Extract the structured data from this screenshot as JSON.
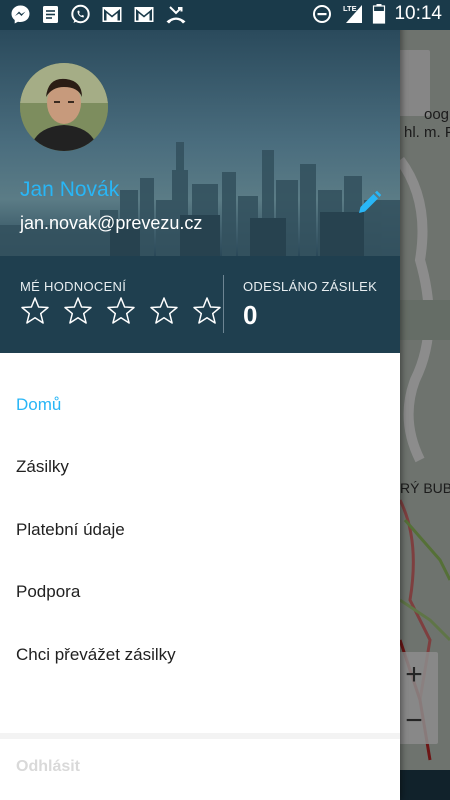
{
  "status_bar": {
    "time": "10:14",
    "network": "LTE",
    "notification_icons": [
      "messenger-icon",
      "document-icon",
      "whatsapp-icon",
      "gmail-icon",
      "gmail-icon",
      "missed-call-icon"
    ]
  },
  "map": {
    "labels": [
      "oog",
      "hl. m. P",
      "RÝ BUBE"
    ],
    "zoom_in": "+",
    "zoom_out": "−"
  },
  "profile": {
    "name": "Jan Novák",
    "email": "jan.novak@prevezu.cz"
  },
  "stats": {
    "rating_label": "MÉ HODNOCENÍ",
    "rating_value": 0,
    "rating_max": 5,
    "sent_label": "ODESLÁNO ZÁSILEK",
    "sent_count": "0"
  },
  "menu": {
    "items": [
      {
        "label": "Domů",
        "active": true
      },
      {
        "label": "Zásilky",
        "active": false
      },
      {
        "label": "Platební údaje",
        "active": false
      },
      {
        "label": "Podpora",
        "active": false
      },
      {
        "label": "Chci převážet zásilky",
        "active": false
      }
    ],
    "logout": "Odhlásit"
  },
  "colors": {
    "accent": "#29b6f6",
    "header_dark": "#1f3f4f",
    "status_bar": "#1a3a4a"
  }
}
